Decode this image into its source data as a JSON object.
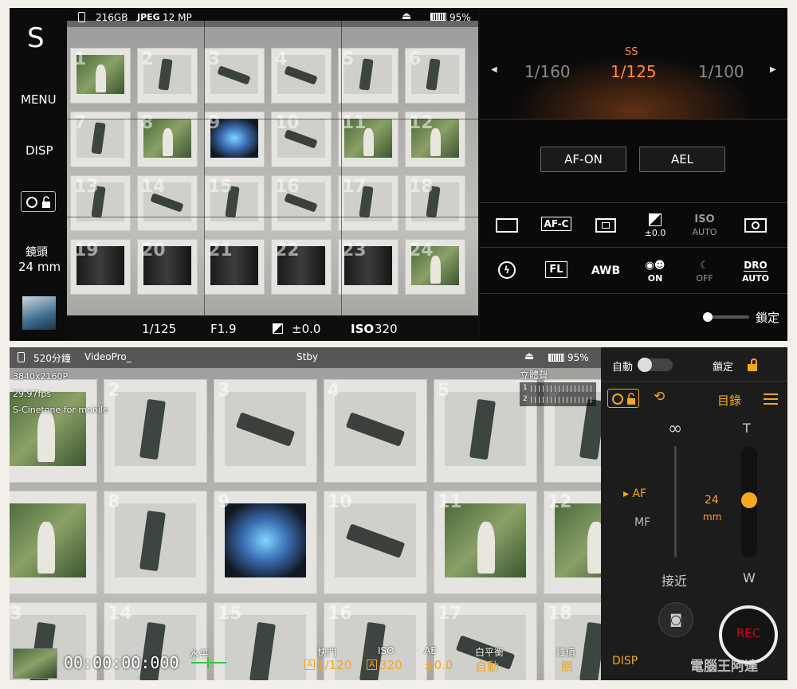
{
  "top": {
    "mode_letter": "S",
    "menu": "MENU",
    "disp": "DISP",
    "lens_label": "鏡頭",
    "lens_value": "24 mm",
    "status": {
      "storage": "216GB",
      "format": "JPEG",
      "resolution": "12 MP",
      "battery": "95%"
    },
    "bottom_bar": {
      "shutter": "1/125",
      "aperture": "F1.9",
      "ev": "±0.0",
      "iso_label": "ISO",
      "iso": "320"
    },
    "ss": {
      "label": "SS",
      "prev": "1/160",
      "current": "1/125",
      "next": "1/100"
    },
    "af_on": "AF-ON",
    "ael": "AEL",
    "icons_row1": [
      {
        "name": "drive-mode",
        "label": "",
        "sub": ""
      },
      {
        "name": "focus-mode",
        "label": "AF-C",
        "sub": ""
      },
      {
        "name": "focus-area",
        "label": "",
        "sub": ""
      },
      {
        "name": "exposure-comp",
        "label": "",
        "sub": "±0.0"
      },
      {
        "name": "iso",
        "label": "ISO",
        "sub": "AUTO"
      },
      {
        "name": "metering",
        "label": "",
        "sub": ""
      }
    ],
    "icons_row2": [
      {
        "name": "flash",
        "label": "",
        "sub": ""
      },
      {
        "name": "creative-look",
        "label": "FL",
        "sub": ""
      },
      {
        "name": "white-balance",
        "label": "AWB",
        "sub": ""
      },
      {
        "name": "face-eye",
        "label": "",
        "sub": "ON"
      },
      {
        "name": "night",
        "label": "",
        "sub": "OFF"
      },
      {
        "name": "dro",
        "label": "DRO",
        "sub": "AUTO"
      }
    ],
    "lock_label": "鎖定"
  },
  "bottom": {
    "status": {
      "remaining": "520分鐘",
      "app": "VideoPro_",
      "state": "Stby",
      "battery": "95%"
    },
    "video_info": [
      "3840x2160P",
      "29.97fps",
      "S-Cinetone for mobile"
    ],
    "stereo_label": "立體聲",
    "audio_channels": [
      "1",
      "2"
    ],
    "timecode": "00:00:00:000",
    "level_label": "水平",
    "params": [
      {
        "label": "快門",
        "value": "1/120",
        "badge": "A"
      },
      {
        "label": "ISO",
        "value": "320",
        "badge": "A"
      },
      {
        "label": "AE",
        "value": "±0.0",
        "badge": ""
      },
      {
        "label": "白平衡",
        "value": "自動",
        "badge": ""
      },
      {
        "label": "峰值",
        "value": "關",
        "badge": ""
      }
    ],
    "right": {
      "auto_label": "自動",
      "lock_label": "鎖定",
      "catalog_label": "目錄",
      "infinity": "∞",
      "tele": "T",
      "af": "AF",
      "mf": "MF",
      "zoom_value": "24",
      "zoom_unit": "mm",
      "near": "接近",
      "wide": "W",
      "disp": "DISP",
      "rec": "REC"
    },
    "watermark": "電腦王阿達"
  },
  "colors": {
    "accent": "#f5a623",
    "rec": "#d0021b",
    "ss_label": "#ff8a3d",
    "ss_current": "#ff8a3d"
  }
}
